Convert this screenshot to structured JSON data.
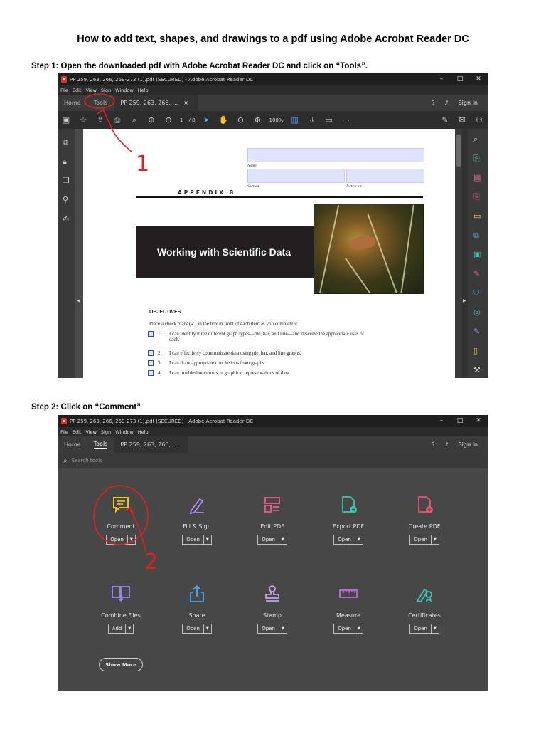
{
  "doc": {
    "title": "How to add text, shapes, and drawings to a pdf using Adobe Acrobat Reader DC",
    "step1": "Step 1: Open the downloaded pdf with Adobe Acrobat Reader DC and click on “Tools”.",
    "step2": "Step 2: Click on “Comment”"
  },
  "window": {
    "title": "PP 259, 263, 266, 269-273 (1).pdf (SECURED) - Adobe Acrobat Reader DC",
    "menu": [
      "File",
      "Edit",
      "View",
      "Sign",
      "Window",
      "Help"
    ],
    "controls": [
      "–",
      "□",
      "✕"
    ]
  },
  "screen1": {
    "tabs": {
      "home": "Home",
      "tools": "Tools",
      "doc": "PP 259, 263, 266, ...",
      "close": "×"
    },
    "sign_in": "Sign In",
    "page_current": "1",
    "page_total": "/ 8",
    "zoom": "100%",
    "pdf": {
      "name_label": "Name",
      "section_label": "Section",
      "instructor_label": "Instructor",
      "appendix": "APPENDIX B",
      "banner": "Working with Scientific Data",
      "objectives_title": "OBJECTIVES",
      "objectives_intro": "Place a check mark (✓) in the box in front of each item as you complete it.",
      "objectives": [
        {
          "num": "1.",
          "text": "I can identify three different graph types—pie, bar, and line—and describe the appropriate uses of each."
        },
        {
          "num": "2.",
          "text": "I can effectively communicate data using pie, bar, and line graphs."
        },
        {
          "num": "3.",
          "text": "I can draw appropriate conclusions from graphs."
        },
        {
          "num": "4.",
          "text": "I can troubleshoot errors in graphical representations of data."
        }
      ]
    },
    "annotation": "1"
  },
  "screen2": {
    "tabs": {
      "home": "Home",
      "tools": "Tools",
      "doc": "PP 259, 263, 266, ..."
    },
    "sign_in": "Sign In",
    "search_placeholder": "Search tools",
    "tools": [
      {
        "name": "Comment",
        "button": "Open",
        "icon": "comment-icon",
        "color": "#f1c40f"
      },
      {
        "name": "Fill & Sign",
        "button": "Open",
        "icon": "fill-sign-icon",
        "color": "#b38cf0"
      },
      {
        "name": "Edit PDF",
        "button": "Open",
        "icon": "edit-pdf-icon",
        "color": "#ef5a8c"
      },
      {
        "name": "Export PDF",
        "button": "Open",
        "icon": "export-pdf-icon",
        "color": "#3fc1b0"
      },
      {
        "name": "Create PDF",
        "button": "Open",
        "icon": "create-pdf-icon",
        "color": "#f0506e"
      },
      {
        "name": "Combine Files",
        "button": "Add",
        "icon": "combine-files-icon",
        "color": "#9b8cf0"
      },
      {
        "name": "Share",
        "button": "Open",
        "icon": "share-icon",
        "color": "#4aa8f0"
      },
      {
        "name": "Stamp",
        "button": "Open",
        "icon": "stamp-icon",
        "color": "#c8a0f0"
      },
      {
        "name": "Measure",
        "button": "Open",
        "icon": "measure-icon",
        "color": "#c56ae0"
      },
      {
        "name": "Certificates",
        "button": "Open",
        "icon": "certificates-icon",
        "color": "#3fc1b0"
      }
    ],
    "show_more": "Show More",
    "annotation": "2"
  },
  "colors": {
    "annotation": "#e02020",
    "app_bg": "#323232",
    "tools_bg": "#474747",
    "accent_blue": "#4fa3f7"
  }
}
